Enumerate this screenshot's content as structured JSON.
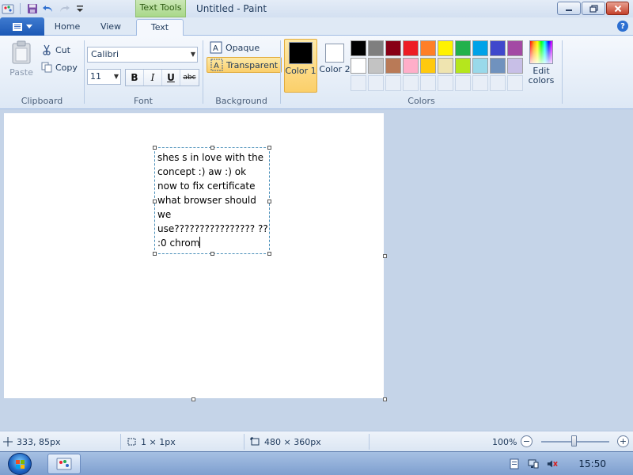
{
  "window": {
    "title": "Untitled - Paint",
    "context_tab": "Text Tools"
  },
  "tabs": [
    {
      "label": "Home"
    },
    {
      "label": "View"
    },
    {
      "label": "Text"
    }
  ],
  "clipboard": {
    "paste": "Paste",
    "cut": "Cut",
    "copy": "Copy",
    "label": "Clipboard"
  },
  "font": {
    "family": "Calibri",
    "size": "11",
    "bold": "B",
    "italic": "I",
    "underline": "U",
    "strike": "abc",
    "label": "Font"
  },
  "background": {
    "opaque": "Opaque",
    "transparent": "Transparent",
    "label": "Background"
  },
  "colors": {
    "color1": "Color 1",
    "color2": "Color 2",
    "edit": "Edit colors",
    "label": "Colors",
    "color1_value": "#000000",
    "color2_value": "#ffffff",
    "palette": [
      "#000000",
      "#7f7f7f",
      "#880015",
      "#ed1c24",
      "#ff7f27",
      "#fff200",
      "#22b14c",
      "#00a2e8",
      "#3f48cc",
      "#a349a4",
      "#ffffff",
      "#c3c3c3",
      "#b97a57",
      "#ffaec9",
      "#ffc90e",
      "#efe4b0",
      "#b5e61d",
      "#99d9ea",
      "#7092be",
      "#c8bfe7"
    ]
  },
  "textbox": {
    "content": "shes s in love with the concept :) aw :) ok now to fix certificate what browser should we use???????????????? ?? :0 chrom"
  },
  "status": {
    "position": "333, 85px",
    "selection": "1 × 1px",
    "size": "480 × 360px",
    "zoom": "100%"
  },
  "taskbar": {
    "time": "15:50"
  }
}
